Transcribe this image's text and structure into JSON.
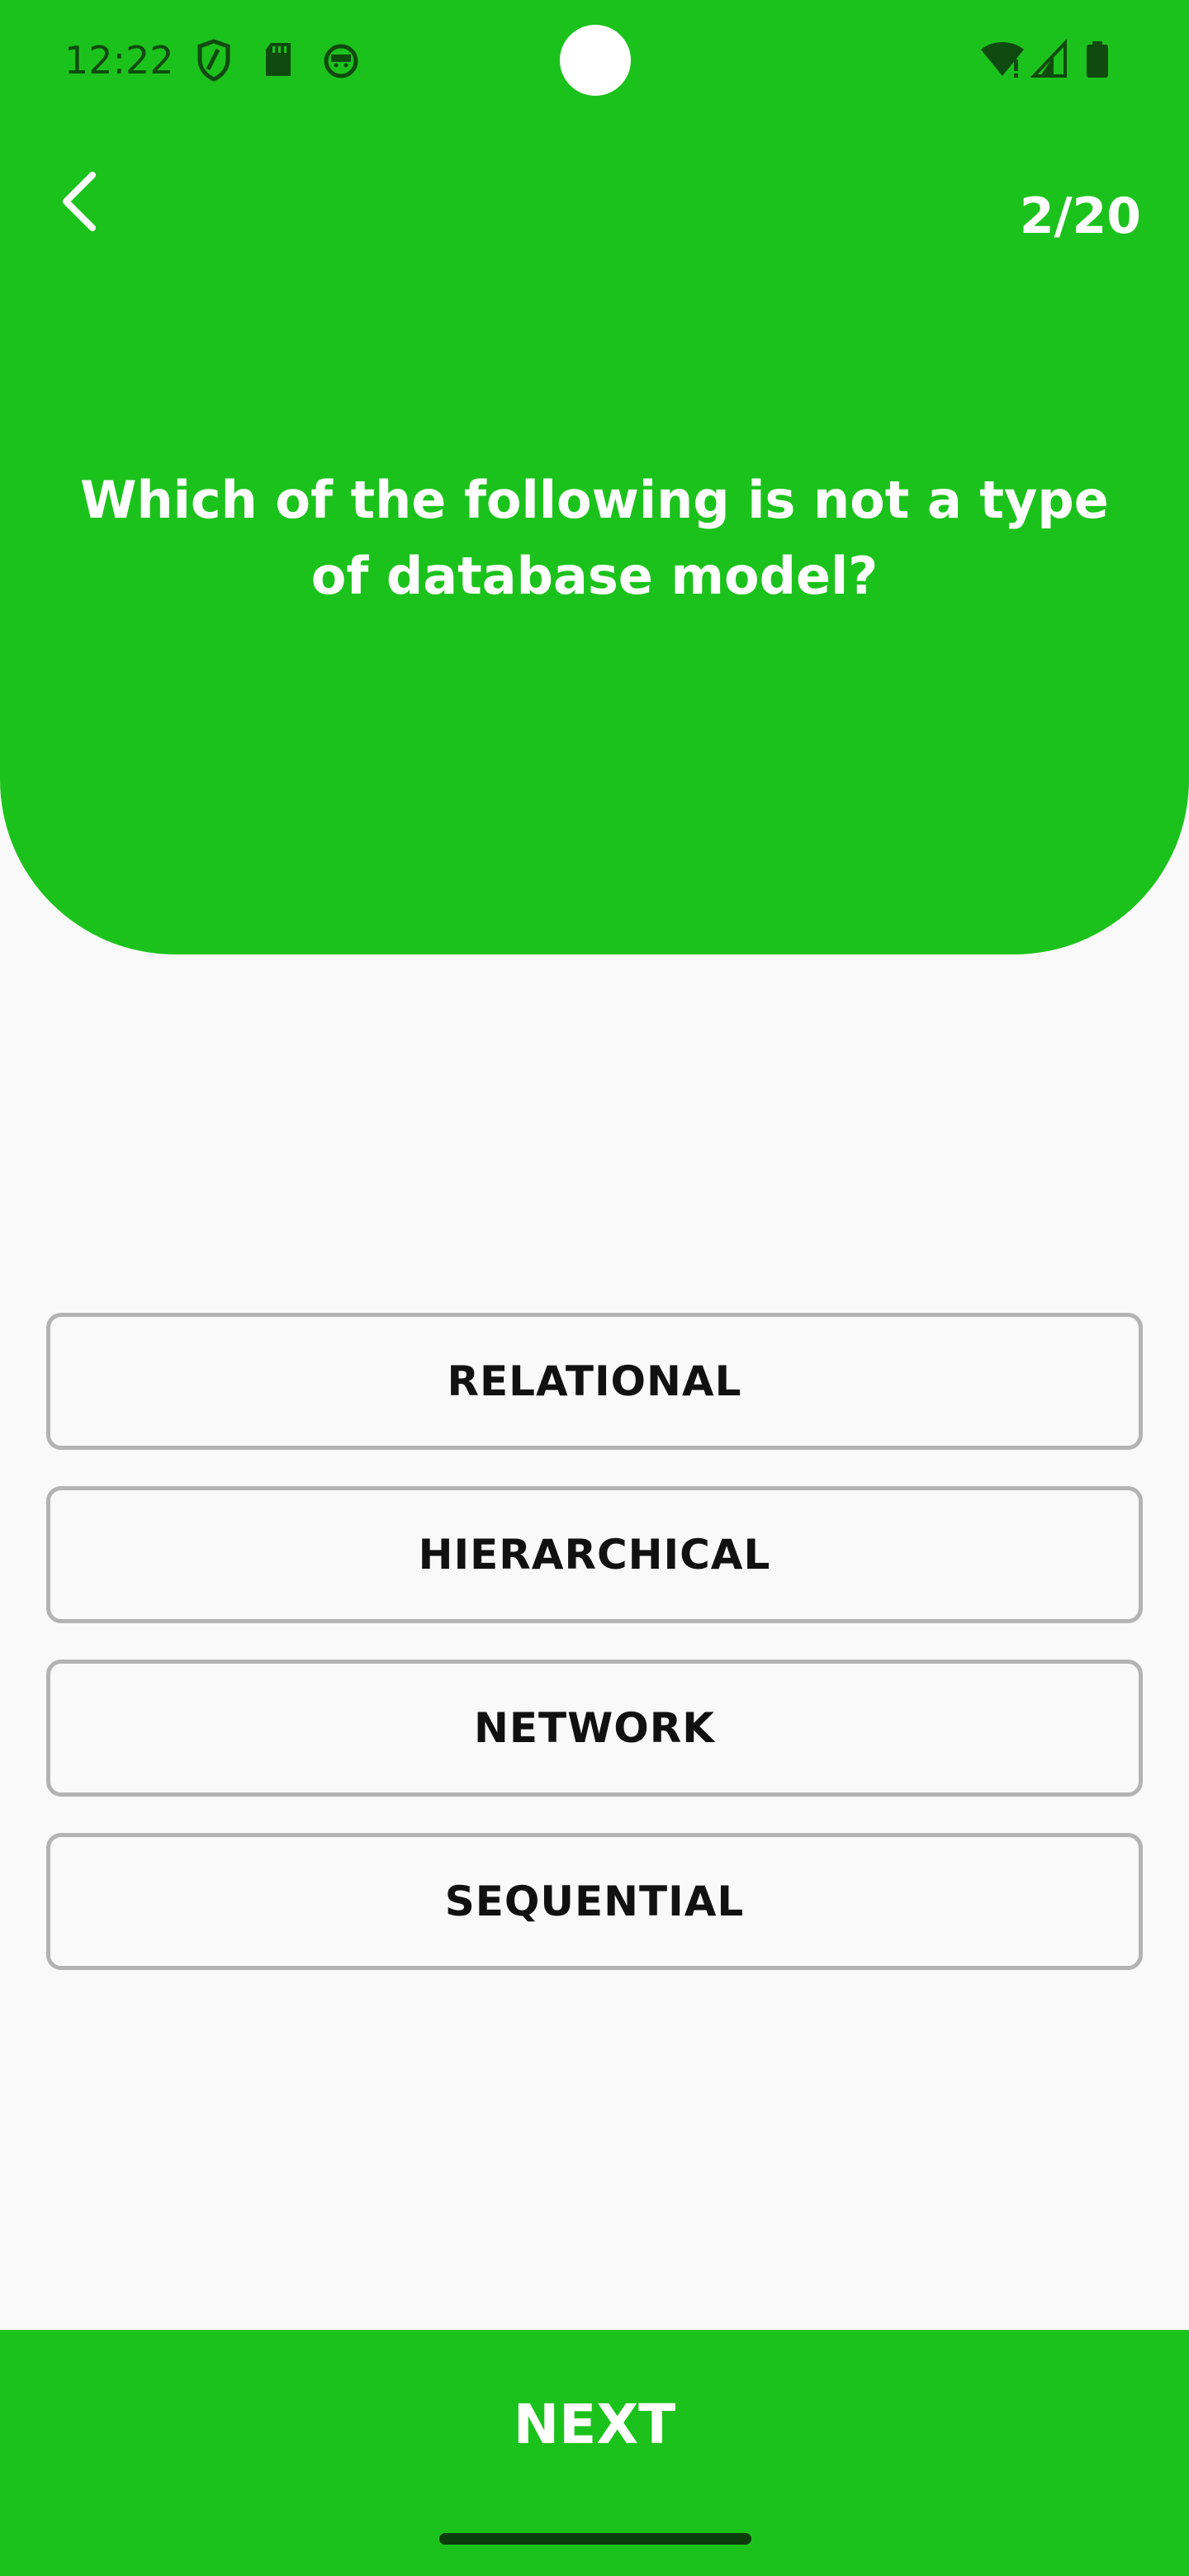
{
  "status_bar": {
    "time": "12:22",
    "icons": [
      "shield-icon",
      "sd-card-icon",
      "app-notification-icon",
      "wifi-alert-icon",
      "signal-icon",
      "battery-icon"
    ]
  },
  "toolbar": {
    "back_icon": "chevron-left-icon",
    "counter": "2/20"
  },
  "question": {
    "text": "Which of the following is not a type of database model?"
  },
  "options": [
    {
      "label": "RELATIONAL"
    },
    {
      "label": "HIERARCHICAL"
    },
    {
      "label": "NETWORK"
    },
    {
      "label": "SEQUENTIAL"
    }
  ],
  "footer": {
    "next_label": "NEXT"
  },
  "colors": {
    "accent": "#1cc21c",
    "background": "#f9f9f9",
    "option_border": "#b3b3b3",
    "text_dark": "#111111",
    "text_light": "#ffffff"
  }
}
